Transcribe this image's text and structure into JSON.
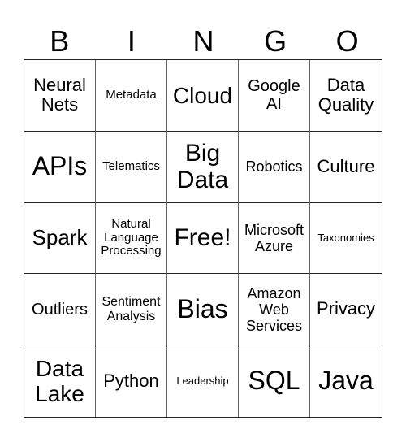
{
  "header": [
    "B",
    "I",
    "N",
    "G",
    "O"
  ],
  "cells": [
    "Neural Nets",
    "Metadata",
    "Cloud",
    "Google AI",
    "Data Quality",
    "APIs",
    "Telematics",
    "Big Data",
    "Robotics",
    "Culture",
    "Spark",
    "Natural Language Processing",
    "Free!",
    "Microsoft Azure",
    "Taxonomies",
    "Outliers",
    "Sentiment Analysis",
    "Bias",
    "Amazon Web Services",
    "Privacy",
    "Data Lake",
    "Python",
    "Leadership",
    "SQL",
    "Java"
  ]
}
